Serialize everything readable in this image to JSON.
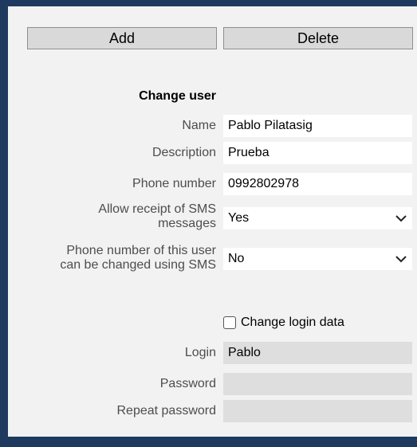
{
  "toolbar": {
    "add_label": "Add",
    "delete_label": "Delete"
  },
  "form": {
    "title": "Change user",
    "name": {
      "label": "Name",
      "value": "Pablo Pilatasig"
    },
    "description": {
      "label": "Description",
      "value": "Prueba"
    },
    "phone": {
      "label": "Phone number",
      "value": "0992802978"
    },
    "sms_receipt": {
      "label_line1": "Allow receipt of SMS",
      "label_line2": "messages",
      "value": "Yes"
    },
    "sms_change": {
      "label_line1": "Phone number of this user",
      "label_line2": "can be changed using SMS",
      "value": "No"
    },
    "change_login": {
      "label": "Change login data",
      "checked": false
    },
    "login": {
      "label": "Login",
      "value": "Pablo"
    },
    "password": {
      "label": "Password",
      "value": ""
    },
    "repeat_password": {
      "label": "Repeat password",
      "value": ""
    }
  },
  "colors": {
    "background": "#1f3a5f",
    "panel": "#f2f2f2",
    "button": "#d9d9d9",
    "disabled_field": "#dedede"
  },
  "icons": {
    "select_arrow": "chevron-down-icon"
  }
}
